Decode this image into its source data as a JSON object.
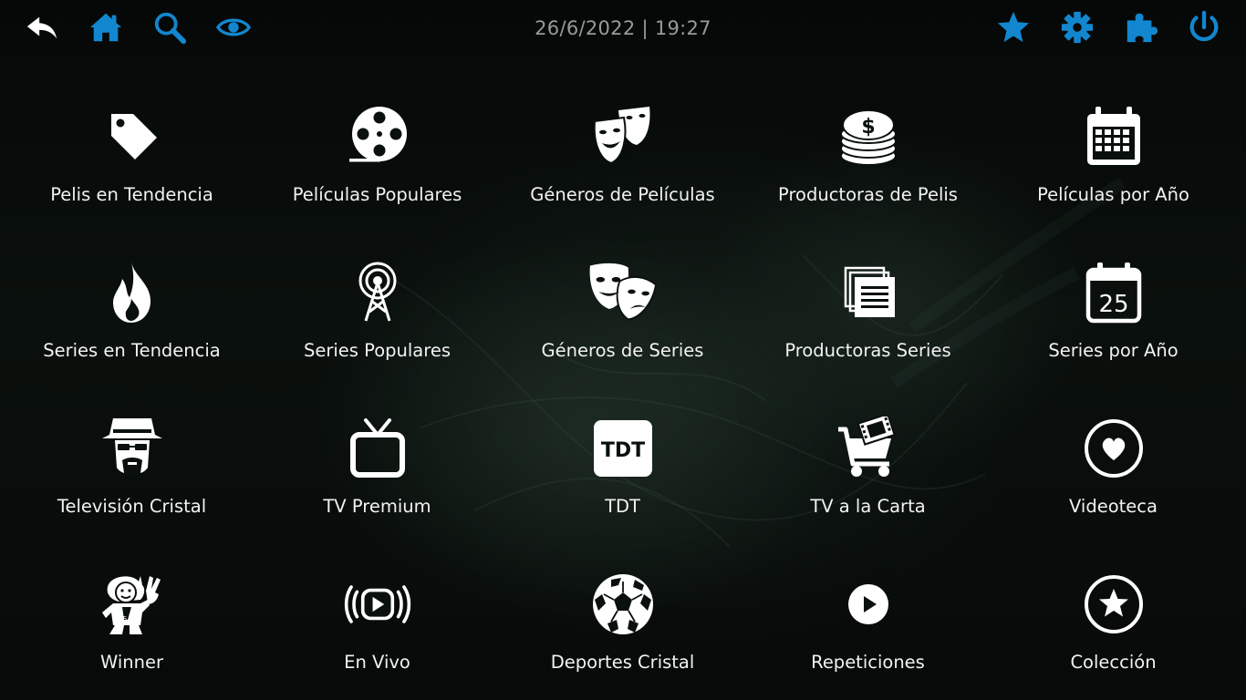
{
  "header": {
    "datetime": "26/6/2022 | 19:27",
    "left_icons": [
      "back-arrow-icon",
      "home-icon",
      "search-icon",
      "eye-icon"
    ],
    "right_icons": [
      "star-icon",
      "gear-icon",
      "puzzle-icon",
      "power-icon"
    ],
    "icon_colors": {
      "back": "#ffffff",
      "accent": "#1287cf"
    }
  },
  "menu": {
    "items": [
      {
        "label": "Pelis en Tendencia",
        "icon": "tag-icon"
      },
      {
        "label": "Películas Populares",
        "icon": "film-reel-icon"
      },
      {
        "label": "Géneros de Películas",
        "icon": "theater-masks-icon"
      },
      {
        "label": "Productoras de Pelis",
        "icon": "coins-icon"
      },
      {
        "label": "Películas por Año",
        "icon": "calendar-grid-icon"
      },
      {
        "label": "Series en Tendencia",
        "icon": "fire-icon"
      },
      {
        "label": "Series Populares",
        "icon": "broadcast-tower-icon"
      },
      {
        "label": "Géneros de Series",
        "icon": "theater-masks-large-icon"
      },
      {
        "label": "Productoras Series",
        "icon": "document-stack-icon"
      },
      {
        "label": "Series por Año",
        "icon": "calendar-25-icon"
      },
      {
        "label": "Televisión Cristal",
        "icon": "hat-man-icon"
      },
      {
        "label": "TV Premium",
        "icon": "tv-icon"
      },
      {
        "label": "TDT",
        "icon": "tdt-icon"
      },
      {
        "label": "TV a la Carta",
        "icon": "cart-film-icon"
      },
      {
        "label": "Videoteca",
        "icon": "heart-circle-icon"
      },
      {
        "label": "Winner",
        "icon": "cartoon-character-icon"
      },
      {
        "label": "En Vivo",
        "icon": "live-broadcast-icon"
      },
      {
        "label": "Deportes Cristal",
        "icon": "soccer-ball-icon"
      },
      {
        "label": "Repeticiones",
        "icon": "play-circle-icon"
      },
      {
        "label": "Colección",
        "icon": "star-circle-icon"
      }
    ],
    "tdt_text": "TDT",
    "calendar_day": "25"
  }
}
